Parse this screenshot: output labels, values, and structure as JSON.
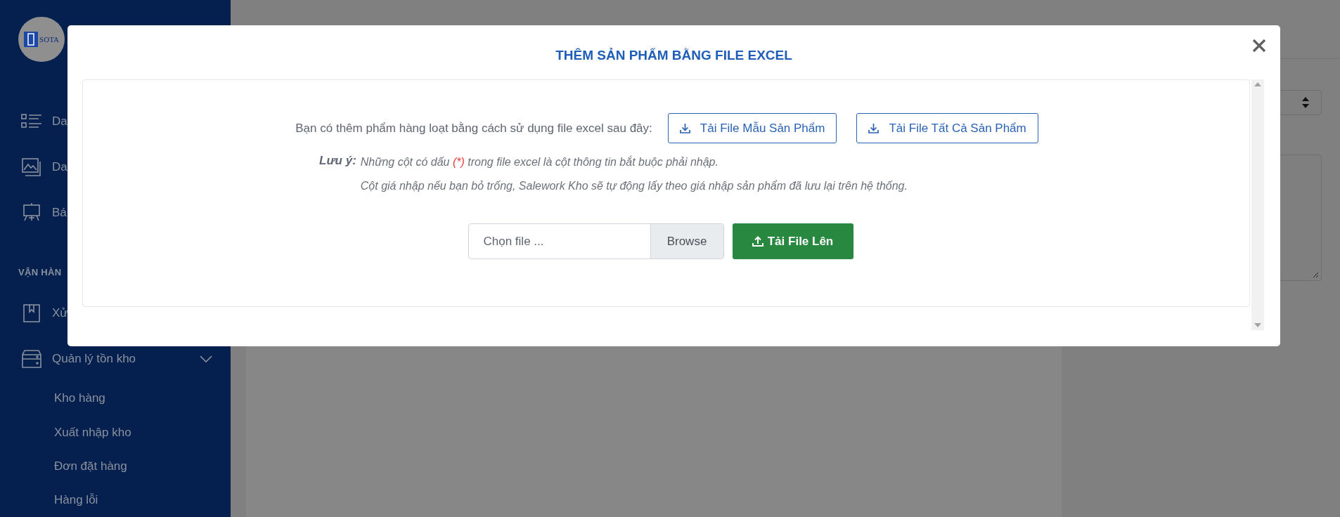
{
  "sidebar": {
    "logo": "SOTA",
    "items": [
      {
        "kind": "item",
        "label": "Da"
      },
      {
        "kind": "item",
        "label": "Da"
      },
      {
        "kind": "item",
        "label": "Bá"
      },
      {
        "kind": "section",
        "label": "VẬN HÀN"
      },
      {
        "kind": "item",
        "label": "Xử"
      },
      {
        "kind": "group",
        "label": "Quản lý tồn kho",
        "expanded": true,
        "children": [
          {
            "label": "Kho hàng"
          },
          {
            "label": "Xuất nhập kho"
          },
          {
            "label": "Đơn đặt hàng"
          },
          {
            "label": "Hàng lỗi"
          }
        ]
      }
    ]
  },
  "modal": {
    "title": "THÊM SẢN PHẨM BẰNG FILE EXCEL",
    "intro": "Bạn có thêm phẩm hàng loạt bằng cách sử dụng file excel sau đây:",
    "download_buttons": [
      "Tải File Mẫu Sản Phẩm",
      "Tải File Tất Cả Sản Phẩm"
    ],
    "note_label": "Lưu ý:",
    "note_lines": [
      [
        {
          "kind": "plain",
          "text": "Những cột có dấu "
        },
        {
          "kind": "required",
          "text": "(*)"
        },
        {
          "kind": "plain",
          "text": " trong file excel là cột thông tin bắt buộc phải nhập."
        }
      ],
      [
        {
          "kind": "plain",
          "text": "Cột giá nhập nếu bạn bỏ trống, Salework Kho sẽ tự động lấy theo giá nhập sản phẩm đã lưu lại trên hệ thống."
        }
      ]
    ],
    "file_input": {
      "placeholder": "Chọn file ...",
      "browse": "Browse"
    },
    "upload_button": "Tải File Lên"
  }
}
